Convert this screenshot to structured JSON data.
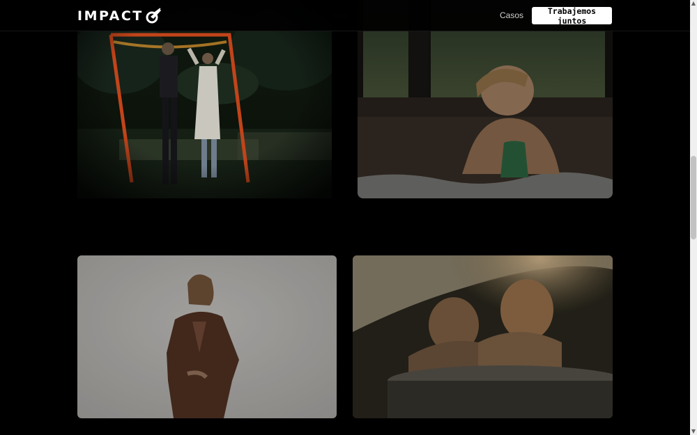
{
  "header": {
    "logo": {
      "text": "IMPACT",
      "mark_icon": "comet-o-icon"
    },
    "nav": {
      "casos_label": "Casos"
    },
    "cta_label": "Trabajemos juntos"
  },
  "gallery": {
    "items": [
      {
        "name": "card-couple-dancing-arch",
        "icon": "photo"
      },
      {
        "name": "card-woman-hot-tub",
        "icon": "photo"
      },
      {
        "name": "card-woman-brown-suit",
        "icon": "photo"
      },
      {
        "name": "card-couple-hot-tub-sunset",
        "icon": "photo"
      }
    ]
  },
  "colors": {
    "background": "#000000",
    "cta_background": "#ffffff",
    "cta_text": "#000000",
    "nav_text": "#cfcfcf"
  }
}
